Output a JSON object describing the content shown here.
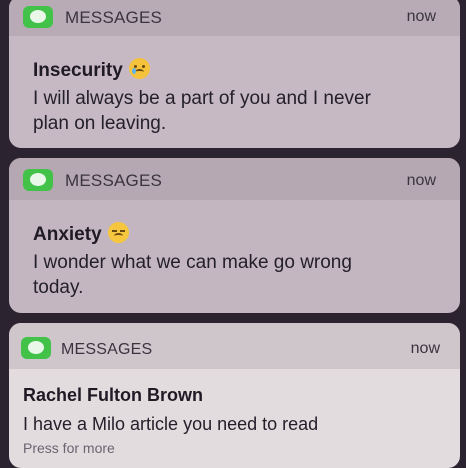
{
  "notifications": [
    {
      "app": "MESSAGES",
      "time": "now",
      "title": "Insecurity",
      "emoji": "crying-face-icon",
      "body_line1": "I will always be a part of you and I never",
      "body_line2": "plan on leaving."
    },
    {
      "app": "MESSAGES",
      "time": "now",
      "title": "Anxiety",
      "emoji": "disappointed-face-icon",
      "body_line1": "I wonder what we can make go wrong",
      "body_line2": "today."
    },
    {
      "app": "MESSAGES",
      "time": "now",
      "title": "Rachel Fulton Brown",
      "body_line1": "I have a Milo article you need to read",
      "footer": "Press for more"
    }
  ],
  "colors": {
    "card_tint": "#c8bcc6",
    "app_icon_green": "#43c24a",
    "background": "#2b2330"
  }
}
